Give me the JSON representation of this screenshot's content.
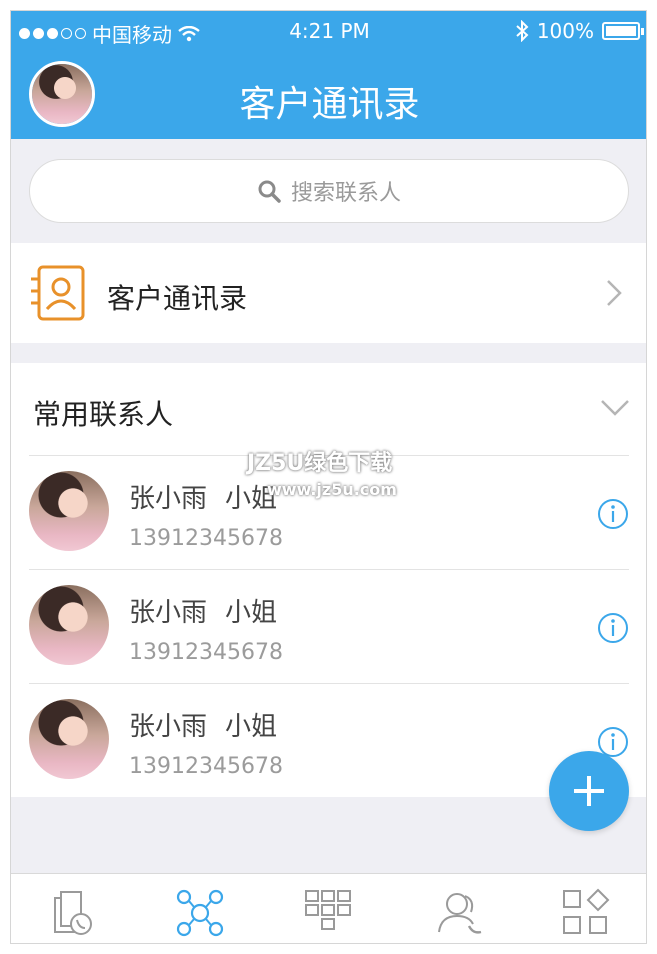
{
  "status_bar": {
    "carrier": "中国移动",
    "time": "4:21 PM",
    "battery": "100%"
  },
  "nav": {
    "title": "客户通讯录"
  },
  "search": {
    "placeholder": "搜索联系人"
  },
  "directory_row": {
    "label": "客户通讯录"
  },
  "favorites": {
    "title": "常用联系人",
    "contacts": [
      {
        "name": "张小雨",
        "title": "小姐",
        "phone": "13912345678"
      },
      {
        "name": "张小雨",
        "title": "小姐",
        "phone": "13912345678"
      },
      {
        "name": "张小雨",
        "title": "小姐",
        "phone": "13912345678"
      }
    ]
  },
  "watermark": {
    "line1": "JZ5U绿色下载",
    "line2": "www.jz5u.com"
  },
  "tabs": [
    {
      "icon": "call-log-icon",
      "active": false
    },
    {
      "icon": "contacts-network-icon",
      "active": true
    },
    {
      "icon": "dialpad-icon",
      "active": false
    },
    {
      "icon": "people-call-icon",
      "active": false
    },
    {
      "icon": "apps-grid-icon",
      "active": false
    }
  ],
  "colors": {
    "accent": "#3ba7ea",
    "directory_icon": "#e8912a",
    "background": "#efeff4"
  }
}
